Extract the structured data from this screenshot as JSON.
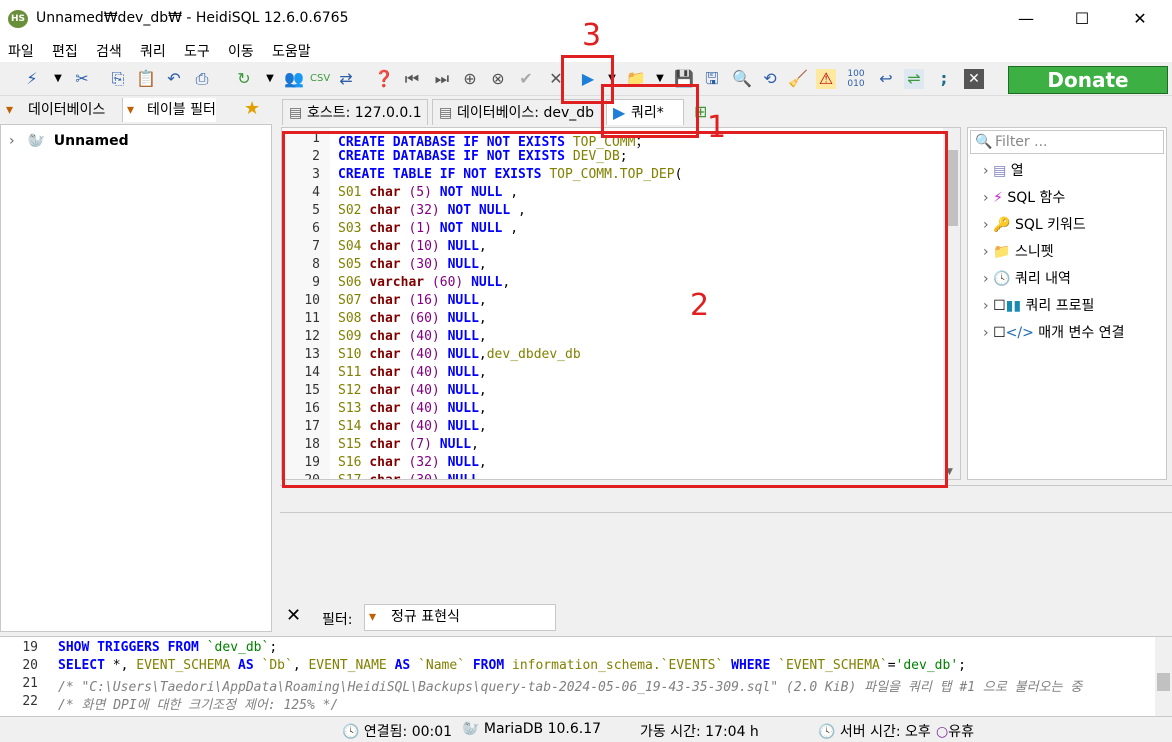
{
  "window": {
    "title": "Unnamed₩dev_db₩ - HeidiSQL 12.6.0.6765",
    "app_icon": "HS"
  },
  "menu": [
    "파일",
    "편집",
    "검색",
    "쿼리",
    "도구",
    "이동",
    "도움말"
  ],
  "donate_label": "Donate",
  "left_tabs": {
    "database": "데이터베이스",
    "table_filter": "테이블 필터"
  },
  "tree": {
    "root": "Unnamed"
  },
  "tabs": {
    "host": "호스트: 127.0.0.1",
    "database": "데이터베이스: dev_db",
    "query": "쿼리*"
  },
  "editor_lines": [
    {
      "n": "1",
      "t": [
        [
          "kw",
          "CREATE DATABASE IF NOT EXISTS "
        ],
        [
          "id",
          "TOP_COMM"
        ],
        [
          "",
          "；"
        ]
      ]
    },
    {
      "n": "2",
      "t": [
        [
          "kw",
          "CREATE DATABASE IF NOT EXISTS "
        ],
        [
          "id",
          "DEV_DB"
        ],
        [
          "",
          ";"
        ]
      ]
    },
    {
      "n": "3",
      "t": [
        [
          "kw",
          "CREATE TABLE IF NOT EXISTS "
        ],
        [
          "id",
          "TOP_COMM.TOP_DEP"
        ],
        [
          "",
          "("
        ]
      ]
    },
    {
      "n": "4",
      "t": [
        [
          "id",
          "S01 "
        ],
        [
          "ty",
          "char"
        ],
        [
          "num",
          " (5) "
        ],
        [
          "kw",
          "NOT NULL"
        ],
        [
          "",
          " ,"
        ]
      ]
    },
    {
      "n": "5",
      "t": [
        [
          "id",
          "S02 "
        ],
        [
          "ty",
          "char"
        ],
        [
          "num",
          " (32) "
        ],
        [
          "kw",
          "NOT NULL"
        ],
        [
          "",
          " ,"
        ]
      ]
    },
    {
      "n": "6",
      "t": [
        [
          "id",
          "S03 "
        ],
        [
          "ty",
          "char"
        ],
        [
          "num",
          " (1) "
        ],
        [
          "kw",
          "NOT NULL"
        ],
        [
          "",
          " ,"
        ]
      ]
    },
    {
      "n": "7",
      "t": [
        [
          "id",
          "S04 "
        ],
        [
          "ty",
          "char"
        ],
        [
          "num",
          " (10) "
        ],
        [
          "kw",
          "NULL"
        ],
        [
          "",
          ","
        ]
      ]
    },
    {
      "n": "8",
      "t": [
        [
          "id",
          "S05 "
        ],
        [
          "ty",
          "char"
        ],
        [
          "num",
          " (30) "
        ],
        [
          "kw",
          "NULL"
        ],
        [
          "",
          ","
        ]
      ]
    },
    {
      "n": "9",
      "t": [
        [
          "id",
          "S06 "
        ],
        [
          "ty",
          "varchar"
        ],
        [
          "num",
          " (60) "
        ],
        [
          "kw",
          "NULL"
        ],
        [
          "",
          ","
        ]
      ]
    },
    {
      "n": "10",
      "t": [
        [
          "id",
          "S07 "
        ],
        [
          "ty",
          "char"
        ],
        [
          "num",
          " (16) "
        ],
        [
          "kw",
          "NULL"
        ],
        [
          "",
          ","
        ]
      ]
    },
    {
      "n": "11",
      "t": [
        [
          "id",
          "S08 "
        ],
        [
          "ty",
          "char"
        ],
        [
          "num",
          " (60) "
        ],
        [
          "kw",
          "NULL"
        ],
        [
          "",
          ","
        ]
      ]
    },
    {
      "n": "12",
      "t": [
        [
          "id",
          "S09 "
        ],
        [
          "ty",
          "char"
        ],
        [
          "num",
          " (40) "
        ],
        [
          "kw",
          "NULL"
        ],
        [
          "",
          ","
        ]
      ]
    },
    {
      "n": "13",
      "t": [
        [
          "id",
          "S10 "
        ],
        [
          "ty",
          "char"
        ],
        [
          "num",
          " (40) "
        ],
        [
          "kw",
          "NULL"
        ],
        [
          "",
          ","
        ],
        [
          "id",
          "dev_dbdev_db"
        ]
      ]
    },
    {
      "n": "14",
      "t": [
        [
          "id",
          "S11 "
        ],
        [
          "ty",
          "char"
        ],
        [
          "num",
          " (40) "
        ],
        [
          "kw",
          "NULL"
        ],
        [
          "",
          ","
        ]
      ]
    },
    {
      "n": "15",
      "t": [
        [
          "id",
          "S12 "
        ],
        [
          "ty",
          "char"
        ],
        [
          "num",
          " (40) "
        ],
        [
          "kw",
          "NULL"
        ],
        [
          "",
          ","
        ]
      ]
    },
    {
      "n": "16",
      "t": [
        [
          "id",
          "S13 "
        ],
        [
          "ty",
          "char"
        ],
        [
          "num",
          " (40) "
        ],
        [
          "kw",
          "NULL"
        ],
        [
          "",
          ","
        ]
      ]
    },
    {
      "n": "17",
      "t": [
        [
          "id",
          "S14 "
        ],
        [
          "ty",
          "char"
        ],
        [
          "num",
          " (40) "
        ],
        [
          "kw",
          "NULL"
        ],
        [
          "",
          ","
        ]
      ]
    },
    {
      "n": "18",
      "t": [
        [
          "id",
          "S15 "
        ],
        [
          "ty",
          "char"
        ],
        [
          "num",
          " (7) "
        ],
        [
          "kw",
          "NULL"
        ],
        [
          "",
          ","
        ]
      ]
    },
    {
      "n": "19",
      "t": [
        [
          "id",
          "S16 "
        ],
        [
          "ty",
          "char"
        ],
        [
          "num",
          " (32) "
        ],
        [
          "kw",
          "NULL"
        ],
        [
          "",
          ","
        ]
      ]
    },
    {
      "n": "20",
      "t": [
        [
          "id",
          "S17 "
        ],
        [
          "ty",
          "char"
        ],
        [
          "num",
          " (30) "
        ],
        [
          "kw",
          "NULL"
        ]
      ]
    }
  ],
  "helper": {
    "filter_placeholder": "Filter ...",
    "items": [
      "열",
      "SQL 함수",
      "SQL 키워드",
      "스니펫",
      "쿼리 내역",
      "쿼리 프로필",
      "매개 변수 연결"
    ]
  },
  "filter_bar": {
    "label": "필터:",
    "regex_placeholder": "정규 표현식"
  },
  "log_lines": [
    {
      "n": "19",
      "t": [
        [
          "kw",
          "SHOW TRIGGERS FROM "
        ],
        [
          "str",
          "`dev_db`"
        ],
        [
          "",
          ";"
        ]
      ]
    },
    {
      "n": "20",
      "t": [
        [
          "kw",
          "SELECT "
        ],
        [
          "",
          "*, "
        ],
        [
          "id",
          "EVENT_SCHEMA "
        ],
        [
          "kw",
          "AS "
        ],
        [
          "id",
          "`Db`"
        ],
        [
          "",
          ", "
        ],
        [
          "id",
          "EVENT_NAME "
        ],
        [
          "kw",
          "AS "
        ],
        [
          "id",
          "`Name` "
        ],
        [
          "kw",
          "FROM "
        ],
        [
          "id",
          "information_schema.`EVENTS` "
        ],
        [
          "kw",
          "WHERE "
        ],
        [
          "id",
          "`EVENT_SCHEMA`"
        ],
        [
          "",
          "="
        ],
        [
          "str",
          "'dev_db'"
        ],
        [
          "",
          ";"
        ]
      ]
    },
    {
      "n": "21",
      "t": [
        [
          "cm",
          "/* \"C:\\Users\\Taedori\\AppData\\Roaming\\HeidiSQL\\Backups\\query-tab-2024-05-06_19-43-35-309.sql\" (2.0 KiB) 파일을 쿼리 탭 #1 으로 불러오는 중"
        ]
      ]
    },
    {
      "n": "22",
      "t": [
        [
          "cm",
          "/* 화면 DPI에 대한 크기조정 제어: 125% */"
        ]
      ]
    }
  ],
  "status": {
    "connected": "연결됨: 00:01",
    "server": "MariaDB 10.6.17",
    "uptime": "가동 시간: 17:04 h",
    "server_time": "서버 시간: 오후",
    "idle": "유휴"
  },
  "annotations": [
    "1",
    "2",
    "3"
  ]
}
